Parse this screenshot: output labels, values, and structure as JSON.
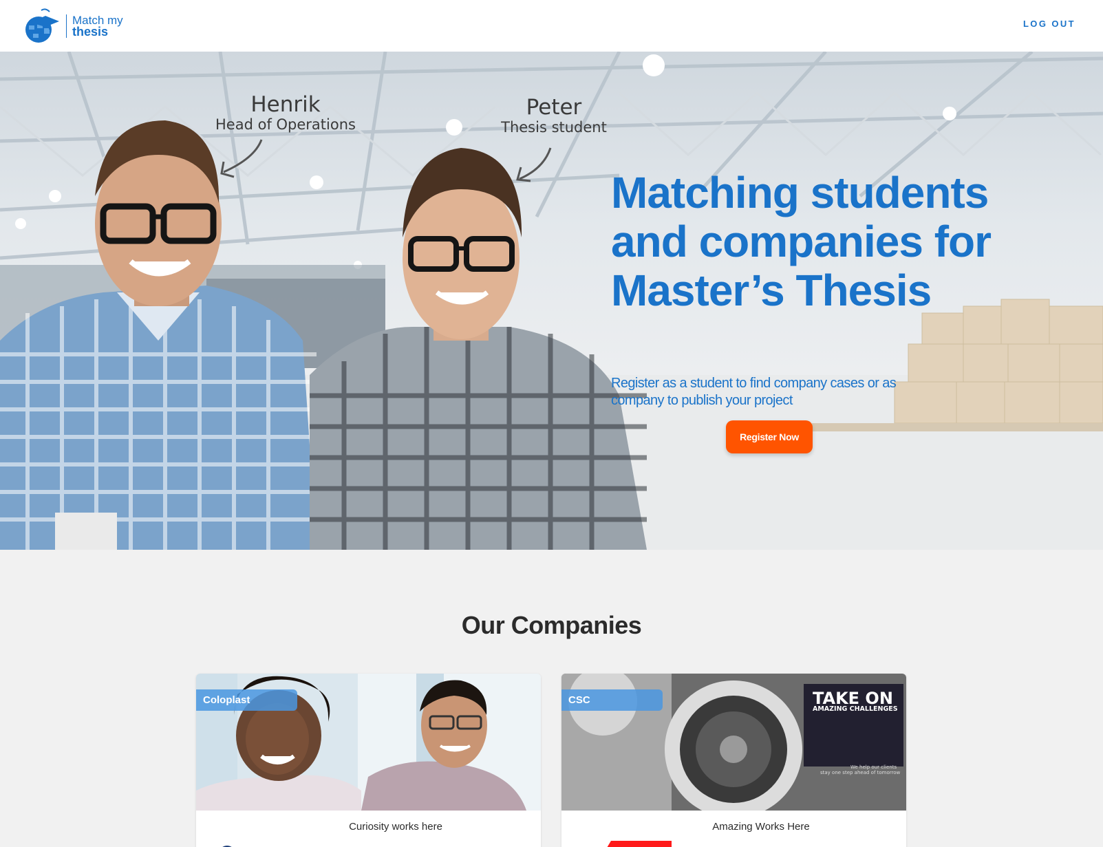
{
  "header": {
    "logo_line1": "Match my",
    "logo_line2": "thesis",
    "logout_label": "LOG OUT"
  },
  "hero": {
    "title": "Matching students and companies for Master’s Thesis",
    "subtitle": "Register as a student to find company cases or as company to publish your project",
    "register_label": "Register Now",
    "person1_name": "Henrik",
    "person1_role": "Head of Operations",
    "person2_name": "Peter",
    "person2_role": "Thesis student"
  },
  "companies": {
    "title": "Our Companies",
    "items": [
      {
        "name": "Coloplast",
        "tagline": "Curiosity works here"
      },
      {
        "name": "CSC",
        "tagline": "Amazing Works Here",
        "ad_headline": "TAKE ON",
        "ad_sub": "AMAZING CHALLENGES",
        "ad_small1": "We help our clients",
        "ad_small2": "stay one step ahead of tomorrow"
      }
    ]
  },
  "colors": {
    "brand_blue": "#1a73c9",
    "cta_orange": "#ff5400",
    "badge_blue": "#4a96e0"
  }
}
